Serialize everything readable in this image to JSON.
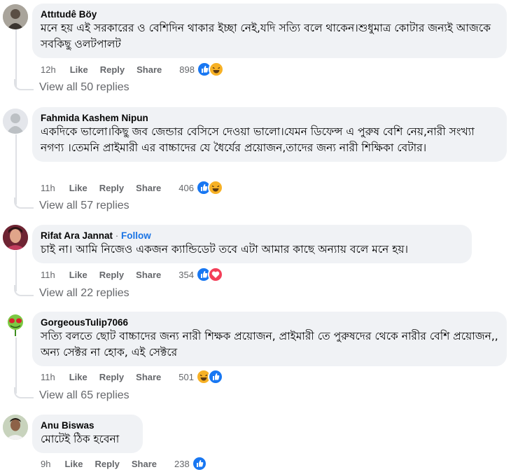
{
  "comments": [
    {
      "author": "Attıtudê Bö̈y",
      "follow": "",
      "text": "মনে হয় এই সরকারের ও বেশিদিন থাকার ইচ্ছা নেই,যদি সত্যি বলে থাকেন।শুধুমাত্র কোটার জন্যই আজকে সবকিছু ওলটপালট",
      "time": "12h",
      "like": "Like",
      "reply": "Reply",
      "share": "Share",
      "reaction_count": "898",
      "reactions": [
        "like-icon",
        "haha-icon"
      ],
      "view_replies": "View all 50 replies"
    },
    {
      "author": "Fahmida Kashem Nipun",
      "follow": "",
      "text": "একদিকে ভালো।কিছু জব জেন্ডার বেসিসে দেওয়া ভালো।যেমন ডিফেন্স এ পুরুষ বেশি নেয়,নারী সংখ্যা নগণ্য ।তেমনি প্রাইমারী এর বাচ্চাদের যে ধৈর্যের প্রয়োজন,তাদের জন্য নারী শিক্ষিকা বেটার।",
      "time": "11h",
      "like": "Like",
      "reply": "Reply",
      "share": "Share",
      "reaction_count": "406",
      "reactions": [
        "like-icon",
        "haha-icon"
      ],
      "view_replies": "View all 57 replies"
    },
    {
      "author": "Rifat Ara Jannat",
      "follow": "Follow",
      "text": "চাই না। আমি নিজেও একজন ক্যান্ডিডেট তবে এটা আমার কাছে অন্যায় বলে মনে হয়।",
      "time": "11h",
      "like": "Like",
      "reply": "Reply",
      "share": "Share",
      "reaction_count": "354",
      "reactions": [
        "like-icon",
        "love-icon"
      ],
      "view_replies": "View all 22 replies"
    },
    {
      "author": "GorgeousTulip7066",
      "follow": "",
      "text": "সত্যি বলতে ছোট বাচ্চাদের জন্য নারী শিক্ষক প্রয়োজন, প্রাইমারী তে পুরুষদের থেকে নারীর বেশি প্রয়োজন,, অন্য সেক্টর না হোক, এই সেক্টরে",
      "time": "11h",
      "like": "Like",
      "reply": "Reply",
      "share": "Share",
      "reaction_count": "501",
      "reactions": [
        "haha-icon",
        "like-icon"
      ],
      "view_replies": "View all 65 replies"
    },
    {
      "author": "Anu Biswas",
      "follow": "",
      "text": "মোটেই ঠিক হবেনা",
      "time": "9h",
      "like": "Like",
      "reply": "Reply",
      "share": "Share",
      "reaction_count": "238",
      "reactions": [
        "like-icon"
      ],
      "view_replies": ""
    }
  ],
  "colors": {
    "bubble": "#f0f2f5",
    "secondary_text": "#65676b",
    "link_blue": "#1b74e4",
    "like_blue": "#1877f2",
    "love_red": "#f33e58",
    "haha_yellow": "#f7b125"
  }
}
